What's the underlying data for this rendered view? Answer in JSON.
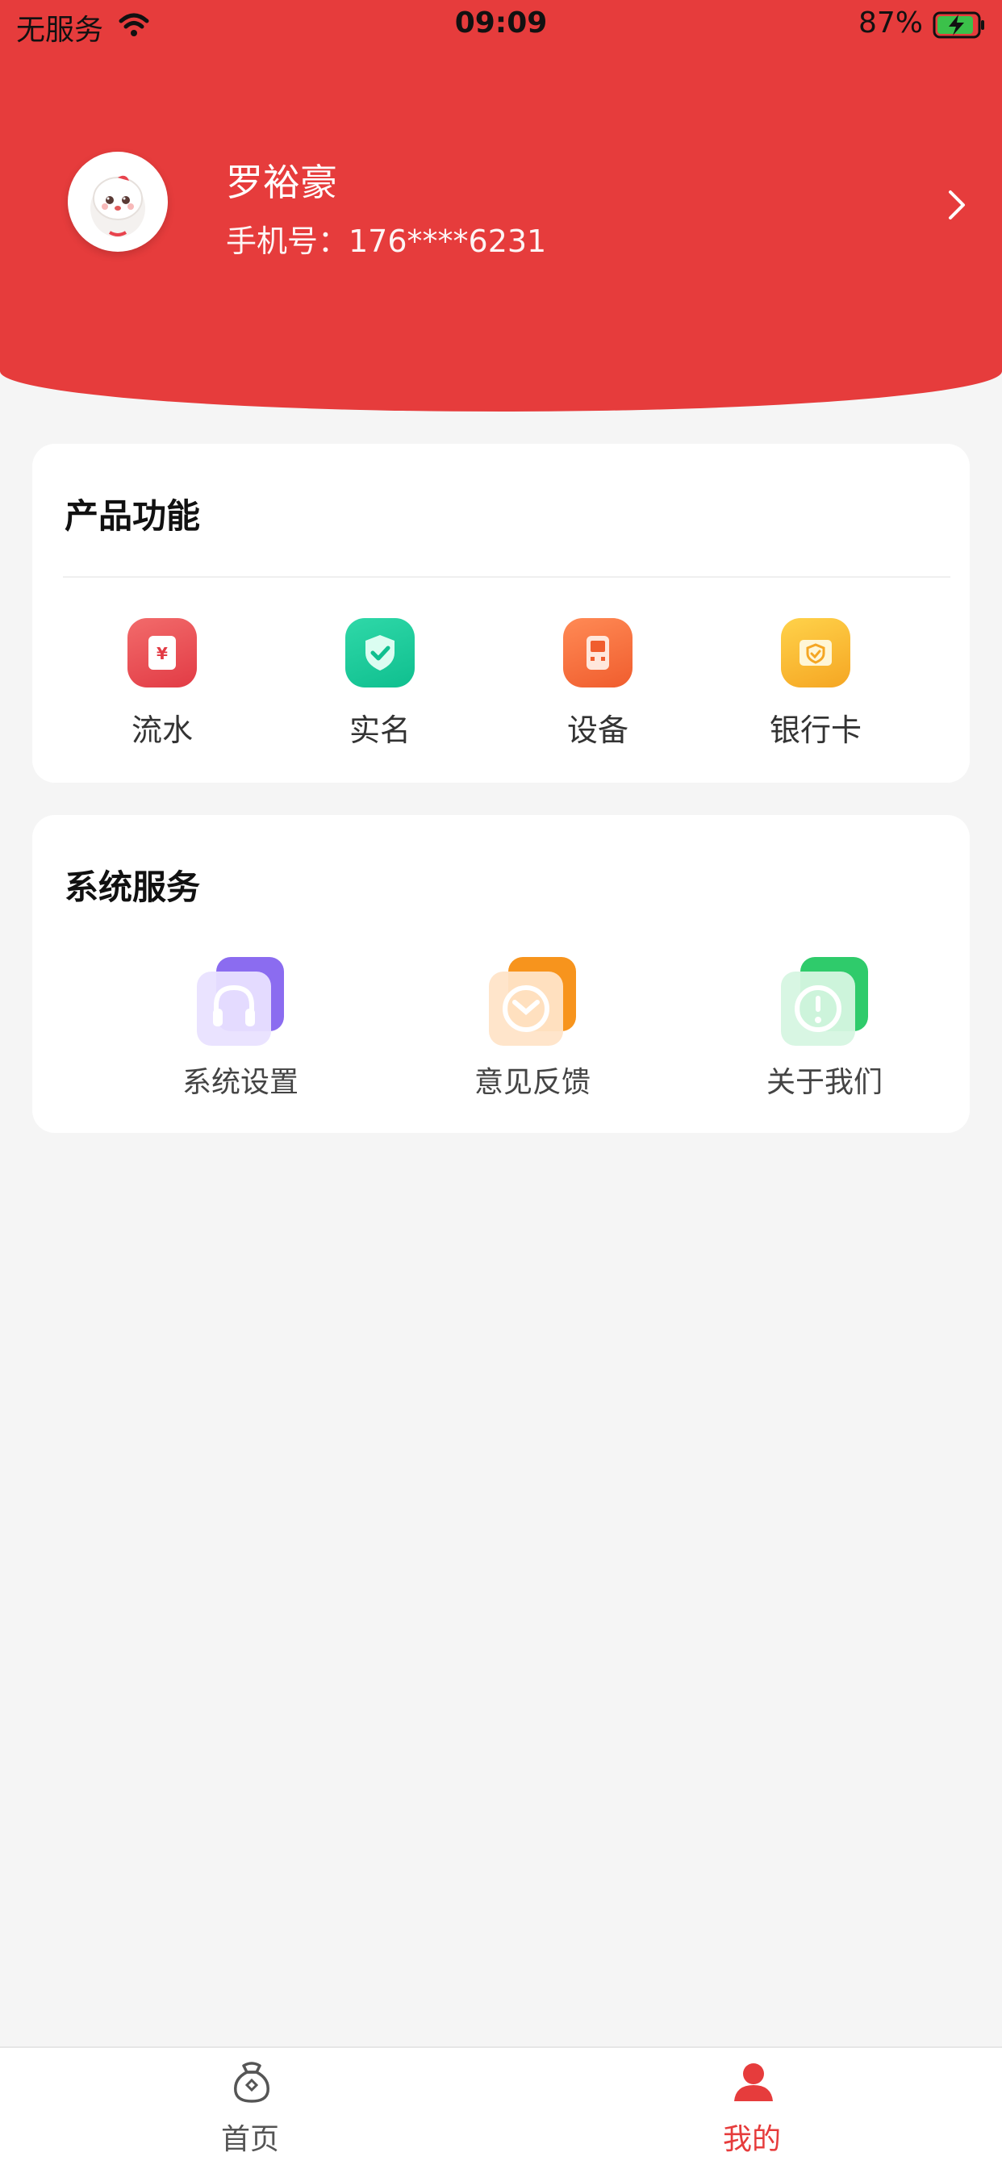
{
  "status_bar": {
    "carrier": "无服务",
    "time": "09:09",
    "battery": "87%"
  },
  "profile": {
    "name": "罗裕豪",
    "phone": "手机号：176****6231"
  },
  "products": {
    "title": "产品功能",
    "items": [
      {
        "label": "流水",
        "icon": "ledger-icon",
        "color": "#e8434d"
      },
      {
        "label": "实名",
        "icon": "shield-check-icon",
        "color": "#13c49a"
      },
      {
        "label": "设备",
        "icon": "device-icon",
        "color": "#f26b3a"
      },
      {
        "label": "银行卡",
        "icon": "bank-card-icon",
        "color": "#f7b731"
      }
    ]
  },
  "services": {
    "title": "系统服务",
    "items": [
      {
        "label": "系统设置",
        "icon": "headset-icon",
        "color": "#8b6cf0"
      },
      {
        "label": "意见反馈",
        "icon": "mail-icon",
        "color": "#f7941d"
      },
      {
        "label": "关于我们",
        "icon": "info-icon",
        "color": "#2fcb6b"
      }
    ]
  },
  "tabbar": {
    "home": "首页",
    "me": "我的",
    "active_color": "#e63c3c"
  }
}
